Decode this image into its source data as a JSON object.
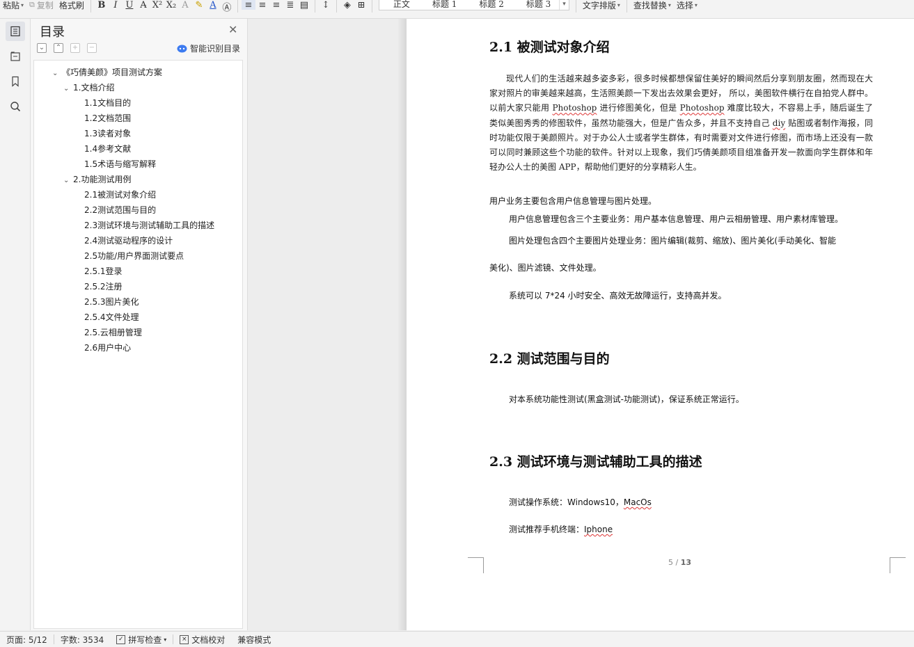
{
  "toolbar": {
    "paste": "粘贴",
    "copy": "复制",
    "format_painter": "格式刷",
    "styles": [
      "正文",
      "标题 1",
      "标题 2",
      "标题 3"
    ],
    "text_layout": "文字排版",
    "find_replace": "查找替换",
    "select": "选择"
  },
  "sidebar": {
    "title": "目录",
    "smart_toc": "智能识别目录",
    "items": [
      {
        "label": "《巧倩美颜》项目测试方案",
        "level": 0
      },
      {
        "label": "1.文档介绍",
        "level": 1
      },
      {
        "label": "1.1文档目的",
        "level": 2
      },
      {
        "label": "1.2文档范围",
        "level": 2
      },
      {
        "label": "1.3读者对象",
        "level": 2
      },
      {
        "label": "1.4参考文献",
        "level": 2
      },
      {
        "label": "1.5术语与缩写解释",
        "level": 2
      },
      {
        "label": "2.功能测试用例",
        "level": 1
      },
      {
        "label": "2.1被测试对象介绍",
        "level": 2
      },
      {
        "label": "2.2测试范围与目的",
        "level": 2
      },
      {
        "label": "2.3测试环境与测试辅助工具的描述",
        "level": 2
      },
      {
        "label": "2.4测试驱动程序的设计",
        "level": 2
      },
      {
        "label": "2.5功能/用户界面测试要点",
        "level": 2
      },
      {
        "label": "2.5.1登录",
        "level": 2
      },
      {
        "label": "2.5.2注册",
        "level": 2
      },
      {
        "label": "2.5.3图片美化",
        "level": 2
      },
      {
        "label": "2.5.4文件处理",
        "level": 2
      },
      {
        "label": "2.5.云相册管理",
        "level": 2
      },
      {
        "label": "2.6用户中心",
        "level": 2
      }
    ]
  },
  "document": {
    "h21": "2.1 被测试对象介绍",
    "para1_pre": "现代人们的生活越来越多姿多彩，很多时候都想保留住美好的瞬间然后分享到朋友圈，然而现在大家对照片的审美越来越高，生活照美颜一下发出去效果会更好， 所以，美图软件横行在自拍党人群中。以前大家只能用 ",
    "photoshop": "Photoshop",
    "para1_mid": " 进行修图美化，但是 ",
    "para1_mid2": " 难度比较大，不容易上手，随后诞生了类似美图秀秀的修图软件，虽然功能强大，但是广告众多，并且不支持自己 ",
    "diy": "diy",
    "para1_post": " 贴图或者制作海报，同时功能仅限于美颜照片。对于办公人士或者学生群体，有时需要对文件进行修图，而市场上还没有一款可以同时兼顾这些个功能的软件。针对以上现象，我们巧倩美颜项目组准备开发一款面向学生群体和年轻办公人士的美图 APP，帮助他们更好的分享精彩人生。",
    "line_business": "用户业务主要包含用户信息管理与图片处理。",
    "line_userinfo": "用户信息管理包含三个主要业务：用户基本信息管理、用户云相册管理、用户素材库管理。",
    "line_image1": "图片处理包含四个主要图片处理业务：图片编辑(裁剪、缩放)、图片美化(手动美化、智能",
    "line_image2": "美化)、图片滤镜、文件处理。",
    "line_system": "系统可以 7*24 小时安全、高效无故障运行，支持高并发。",
    "h22": "2.2 测试范围与目的",
    "line_scope": "对本系统功能性测试(黑盒测试-功能测试)，保证系统正常运行。",
    "h23": "2.3 测试环境与测试辅助工具的描述",
    "os_label": "测试操作系统：",
    "os_value1": "Windows10，",
    "os_value2": "MacOs",
    "phone_label": "测试推荐手机终端：",
    "phone_value": "Iphone",
    "page_current": "5",
    "page_sep": " / ",
    "page_total": "13"
  },
  "status": {
    "page": "页面: 5/12",
    "words": "字数: 3534",
    "spell": "拼写检查",
    "proof": "文档校对",
    "compat": "兼容模式"
  }
}
